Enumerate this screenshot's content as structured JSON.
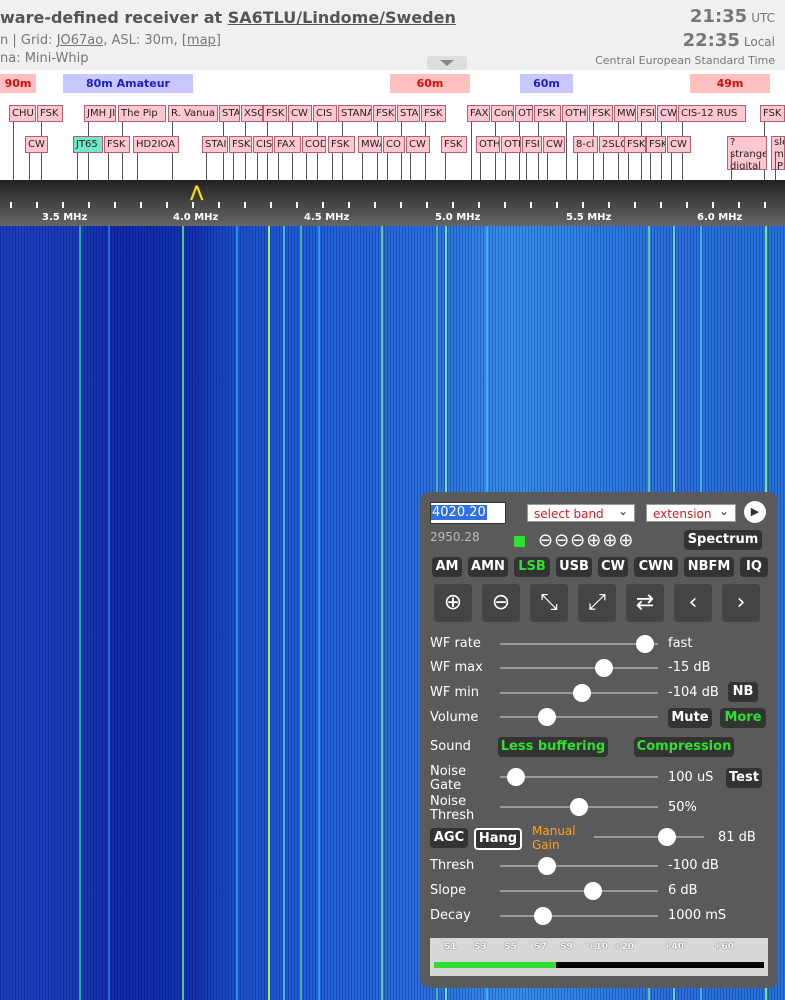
{
  "header": {
    "title_prefix": "ware-defined receiver at ",
    "title_link": "SA6TLU/Lindome/Sweden",
    "line2_prefix": "n | Grid: ",
    "grid": "JO67ao",
    "line2_mid": ", ASL: 30m, ",
    "map_link": "[map]",
    "line3": "na: Mini-Whip",
    "utc_time": "21:35",
    "utc_label": "UTC",
    "local_time": "22:35",
    "local_label": "Local",
    "timezone": "Central European Standard Time"
  },
  "bands": [
    {
      "label": "90m",
      "color": "red"
    },
    {
      "label": "80m Amateur",
      "color": "blue"
    },
    {
      "label": "60m",
      "color": "red"
    },
    {
      "label": "60m",
      "color": "blue"
    },
    {
      "label": "49m",
      "color": "red"
    }
  ],
  "stations_row1": [
    "CHU",
    "FSK",
    "JMH JI",
    "The Pip",
    "R. Vanua",
    "STA",
    "XSG",
    "FSK",
    "CW",
    "CIS",
    "STANA",
    "FSK",
    "STA",
    "FSK",
    "FAX",
    "Con",
    "OTI",
    "FSK",
    "OTH",
    "FSK",
    "MW",
    "FSI",
    "CW",
    "CIS-12 RUS",
    "FSK"
  ],
  "stations_row2": [
    "CW",
    "JT65",
    "FSK",
    "HD2IOA",
    "STAI",
    "FSK",
    "CIS",
    "FAX 1",
    "COD",
    "FSK",
    "MWA",
    "CO",
    "CW",
    "FSK",
    "OTH",
    "OTI",
    "FSI",
    "CW",
    "8-cl",
    "2SLC",
    "FSK",
    "FSK",
    "CW",
    "?strange digital",
    "sle ma JP"
  ],
  "scale": {
    "labels": [
      "3.5 MHz",
      "4.0 MHz",
      "4.5 MHz",
      "5.0 MHz",
      "5.5 MHz",
      "6.0 MHz"
    ]
  },
  "panel": {
    "frequency": "4020.20",
    "subfreq": "2950.28",
    "band_select": "select band",
    "extension_select": "extension",
    "spectrum_label": "Spectrum",
    "zoom_symbols": "⊖⊖⊖⊕⊕⊕",
    "modes": [
      "AM",
      "AMN",
      "LSB",
      "USB",
      "CW",
      "CWN",
      "NBFM",
      "IQ"
    ],
    "active_mode": "LSB",
    "wf_rate": {
      "label": "WF rate",
      "value": "fast",
      "level": 0.97
    },
    "wf_max": {
      "label": "WF max",
      "value": "-15 dB",
      "level": 0.68
    },
    "wf_min": {
      "label": "WF min",
      "value": "-104 dB",
      "level": 0.52
    },
    "nb_label": "NB",
    "volume": {
      "label": "Volume",
      "level": 0.27
    },
    "mute_label": "Mute",
    "more_label": "More",
    "sound_label": "Sound",
    "less_buffering": "Less buffering",
    "compression": "Compression",
    "noise_gate": {
      "label1": "Noise",
      "label2": "Gate",
      "value": "100 uS",
      "level": 0.05
    },
    "test_label": "Test",
    "noise_thresh": {
      "label1": "Noise",
      "label2": "Thresh",
      "value": "50%",
      "level": 0.5
    },
    "agc_label": "AGC",
    "hang_label": "Hang",
    "manual_gain1": "Manual",
    "manual_gain2": "Gain",
    "manual_gain_value": "81 dB",
    "manual_gain_level": 0.7,
    "thresh": {
      "label": "Thresh",
      "value": "-100 dB",
      "level": 0.27
    },
    "slope": {
      "label": "Slope",
      "value": "6 dB",
      "level": 0.6
    },
    "decay": {
      "label": "Decay",
      "value": "1000 mS",
      "level": 0.24
    },
    "smeter_labels": [
      "S1",
      "S3",
      "S5",
      "S7",
      "S9",
      "+10",
      "+20",
      "+40",
      "+60"
    ],
    "smeter_level": 0.37
  },
  "colors": {
    "panel_bg": "#5a5a5a",
    "active_green": "#30e030",
    "band_red": "#ffc0c0",
    "band_blue": "#c8c8ff",
    "manual_gain_orange": "#ffa020"
  }
}
